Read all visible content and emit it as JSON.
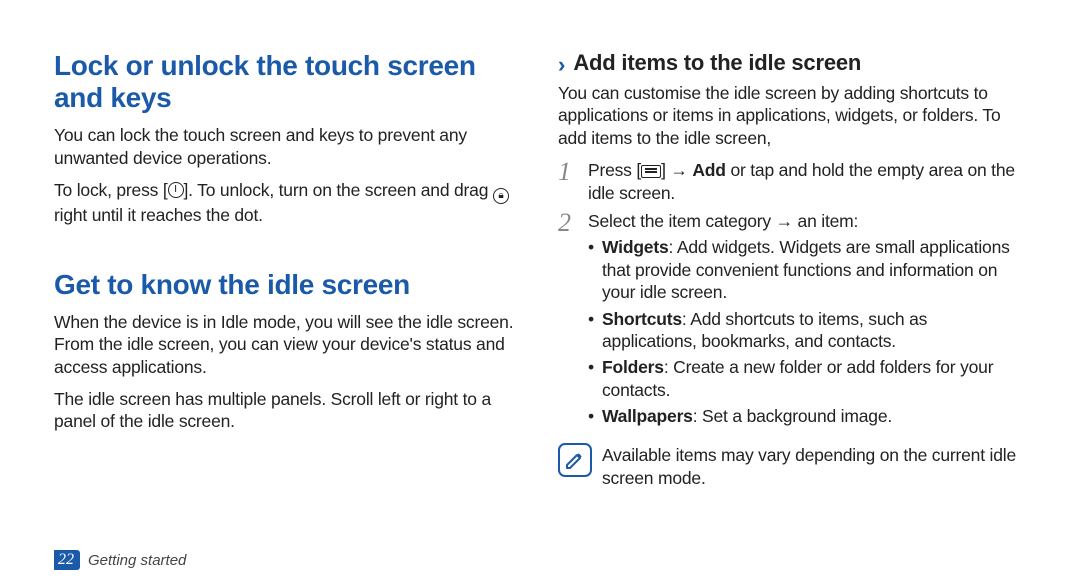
{
  "left": {
    "h1a": "Lock or unlock the touch screen and keys",
    "p1": "You can lock the touch screen and keys to prevent any unwanted device operations.",
    "p2a": "To lock, press [",
    "p2b": "]. To unlock, turn on the screen and drag ",
    "p2c": " right until it reaches the dot.",
    "h1b": "Get to know the idle screen",
    "p3": "When the device is in Idle mode, you will see the idle screen. From the idle screen, you can view your device's status and access applications.",
    "p4": "The idle screen has multiple panels. Scroll left or right to a panel of the idle screen."
  },
  "right": {
    "sub": "Add items to the idle screen",
    "intro": "You can customise the idle screen by adding shortcuts to applications or items in applications, widgets, or folders. To add items to the idle screen,",
    "steps": [
      {
        "num": "1",
        "pre": "Press [",
        "mid": "] → ",
        "boldword": "Add",
        "post": " or tap and hold the empty area on the idle screen."
      },
      {
        "num": "2",
        "line": "Select the item category → an item:",
        "bullets": [
          {
            "label": "Widgets",
            "text": ": Add widgets. Widgets are small applications that provide convenient functions and information on your idle screen."
          },
          {
            "label": "Shortcuts",
            "text": ": Add shortcuts to items, such as applications, bookmarks, and contacts."
          },
          {
            "label": "Folders",
            "text": ": Create a new folder or add folders for your contacts."
          },
          {
            "label": "Wallpapers",
            "text": ": Set a background image."
          }
        ]
      }
    ],
    "note": "Available items may vary depending on the current idle screen mode."
  },
  "footer": {
    "page": "22",
    "section": "Getting started"
  }
}
